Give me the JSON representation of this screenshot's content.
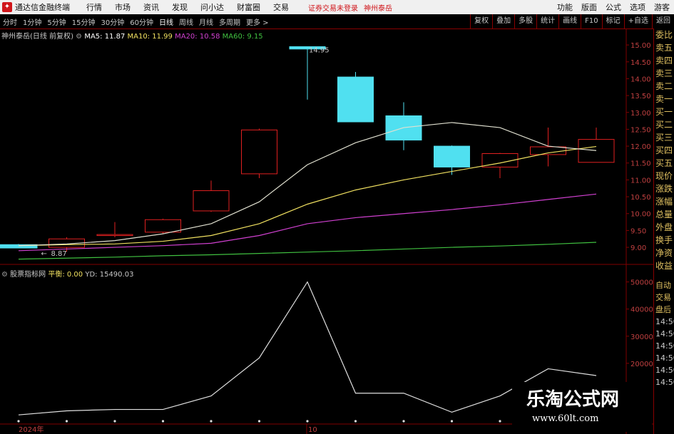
{
  "app": {
    "name": "通达信金融终端",
    "warning": "证券交易未登录",
    "stock_name": "神州泰岳"
  },
  "menu": [
    "行情",
    "市场",
    "资讯",
    "发现",
    "问小达",
    "财富圈",
    "交易"
  ],
  "right_menu": [
    "功能",
    "版面",
    "公式",
    "选项",
    "游客"
  ],
  "timeframes": [
    {
      "label": "分时"
    },
    {
      "label": "1分钟"
    },
    {
      "label": "5分钟"
    },
    {
      "label": "15分钟"
    },
    {
      "label": "30分钟"
    },
    {
      "label": "60分钟"
    },
    {
      "label": "日线",
      "active": true
    },
    {
      "label": "周线"
    },
    {
      "label": "月线"
    },
    {
      "label": "多周期"
    },
    {
      "label": "更多 >"
    }
  ],
  "right_tools": [
    "复权",
    "叠加",
    "多股",
    "统计",
    "画线",
    "F10",
    "标记",
    "+自选",
    "返回"
  ],
  "main_header": {
    "title": "神州泰岳(日线 前复权)",
    "ma5": "MA5: 11.87",
    "ma10": "MA10: 11.99",
    "ma20": "MA20: 10.58",
    "ma60": "MA60: 9.15",
    "ma5_color": "#ffffff",
    "ma10_color": "#f0e060",
    "ma20_color": "#d040d0",
    "ma60_color": "#40c040"
  },
  "sub_header": {
    "title": "股票指标网",
    "balance": "平衡: 0.00",
    "yd": "YD: 15490.03"
  },
  "price_axis": {
    "ticks": [
      "15.00",
      "14.50",
      "14.00",
      "13.50",
      "13.00",
      "12.50",
      "12.00",
      "11.50",
      "11.00",
      "10.50",
      "10.00",
      "9.50",
      "9.00"
    ]
  },
  "sub_axis": {
    "ticks": [
      "50000",
      "40000",
      "30000",
      "20000"
    ]
  },
  "annotations": {
    "high": "14.95",
    "low": "8.87"
  },
  "x_labels": {
    "year": "2024年",
    "month": "10"
  },
  "sidebar": {
    "top": [
      "委比",
      "卖五",
      "卖四",
      "卖三",
      "卖二",
      "卖一",
      "买一",
      "买二",
      "买三",
      "买四",
      "买五",
      "现价",
      "涨跌",
      "涨幅",
      "总量",
      "外盘",
      "换手",
      "净资",
      "收益"
    ],
    "bottom": [
      "自动",
      "交易",
      "盘后",
      "14:50",
      "14:50",
      "14:50",
      "14:50",
      "14:50",
      "14:50"
    ]
  },
  "watermark": {
    "text": "乐淘公式网",
    "url": "www.60lt.com"
  },
  "colors": {
    "up": "#e02020",
    "down": "#50e0f0",
    "grid": "#800000",
    "axis_text": "#c04040"
  },
  "chart_data": {
    "type": "candlestick",
    "candles": [
      {
        "o": 9.08,
        "h": 9.1,
        "l": 8.98,
        "c": 8.98
      },
      {
        "o": 9.0,
        "h": 9.3,
        "l": 8.87,
        "c": 9.25
      },
      {
        "o": 9.35,
        "h": 9.75,
        "l": 9.3,
        "c": 9.38
      },
      {
        "o": 9.45,
        "h": 9.85,
        "l": 9.4,
        "c": 9.82
      },
      {
        "o": 10.08,
        "h": 10.98,
        "l": 10.05,
        "c": 10.68
      },
      {
        "o": 11.18,
        "h": 12.52,
        "l": 11.05,
        "c": 12.48
      },
      {
        "o": 14.95,
        "h": 14.95,
        "l": 13.38,
        "c": 14.88
      },
      {
        "o": 14.05,
        "h": 14.2,
        "l": 12.8,
        "c": 12.72
      },
      {
        "o": 12.9,
        "h": 13.3,
        "l": 11.88,
        "c": 12.18
      },
      {
        "o": 12.0,
        "h": 12.02,
        "l": 11.15,
        "c": 11.38
      },
      {
        "o": 11.38,
        "h": 11.8,
        "l": 11.05,
        "c": 11.78
      },
      {
        "o": 11.75,
        "h": 12.55,
        "l": 11.4,
        "c": 11.98
      },
      {
        "o": 11.52,
        "h": 12.55,
        "l": 11.52,
        "c": 12.2
      }
    ],
    "ma5": [
      9.05,
      9.1,
      9.2,
      9.4,
      9.7,
      10.35,
      11.45,
      12.1,
      12.55,
      12.7,
      12.55,
      12.0,
      11.87
    ],
    "ma10": [
      9.05,
      9.08,
      9.1,
      9.18,
      9.35,
      9.7,
      10.28,
      10.7,
      11.0,
      11.25,
      11.5,
      11.8,
      11.99
    ],
    "ma20": [
      8.9,
      8.95,
      9.0,
      9.05,
      9.12,
      9.35,
      9.7,
      9.88,
      10.0,
      10.12,
      10.26,
      10.42,
      10.58
    ],
    "ma60": [
      8.65,
      8.68,
      8.71,
      8.75,
      8.78,
      8.82,
      8.86,
      8.9,
      8.95,
      9.0,
      9.04,
      9.09,
      9.15
    ],
    "yrange": [
      8.6,
      15.15
    ],
    "indicator": [
      1000,
      2500,
      3000,
      3000,
      8000,
      22000,
      50000,
      9000,
      9000,
      2000,
      8000,
      18000,
      15490
    ],
    "indicator_range": [
      0,
      52000
    ]
  }
}
